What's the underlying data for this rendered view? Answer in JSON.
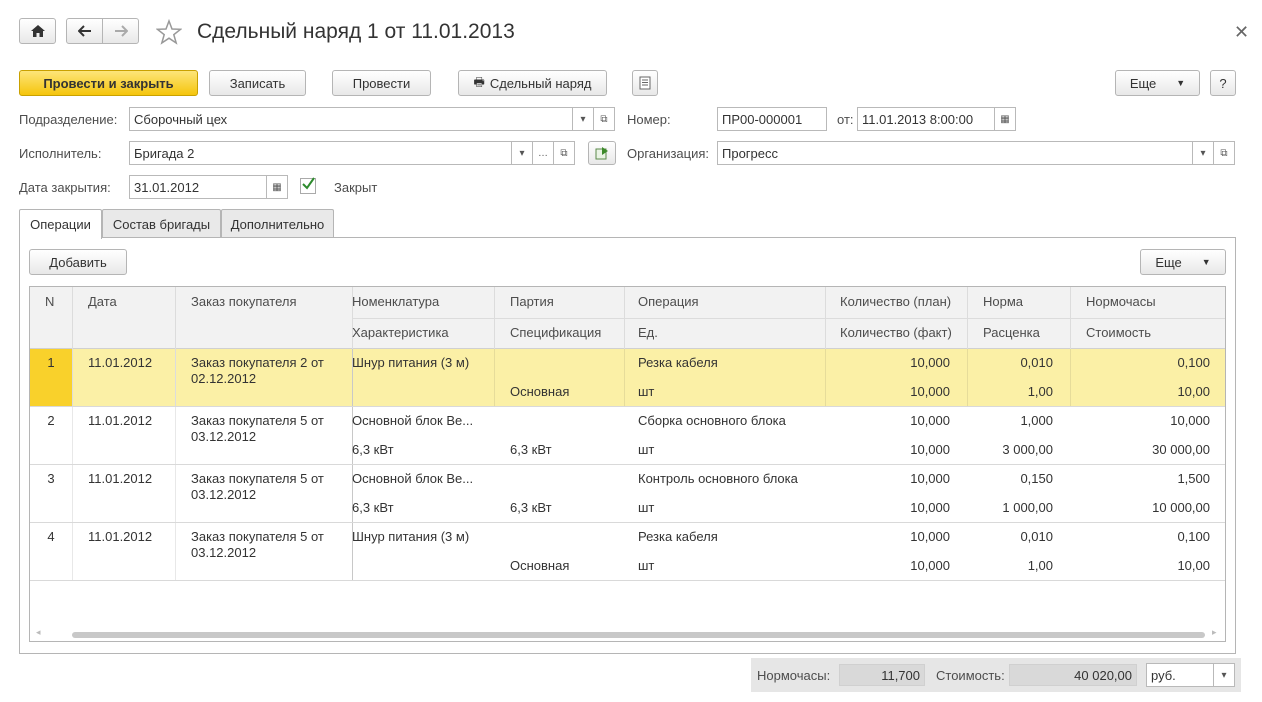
{
  "window": {
    "title": "Сдельный наряд 1 от 11.01.2013"
  },
  "toolbar": {
    "post_close": "Провести и закрыть",
    "save": "Записать",
    "post": "Провести",
    "print": "Сдельный наряд",
    "more": "Еще",
    "help": "?"
  },
  "form": {
    "division_label": "Подразделение:",
    "division_value": "Сборочный цех",
    "number_label": "Номер:",
    "number_value": "ПР00-000001",
    "from_label": "от:",
    "date_value": "11.01.2013  8:00:00",
    "executor_label": "Исполнитель:",
    "executor_value": "Бригада 2",
    "org_label": "Организация:",
    "org_value": "Прогресс",
    "close_date_label": "Дата закрытия:",
    "close_date_value": "31.01.2012",
    "closed_label": "Закрыт"
  },
  "tabs": [
    {
      "label": "Операции"
    },
    {
      "label": "Состав бригады"
    },
    {
      "label": "Дополнительно"
    }
  ],
  "table_toolbar": {
    "add": "Добавить",
    "more": "Еще"
  },
  "columns": {
    "n": "N",
    "date": "Дата",
    "order": "Заказ покупателя",
    "nomenclature": "Номенклатура",
    "characteristic": "Характеристика",
    "batch": "Партия",
    "spec": "Спецификация",
    "operation": "Операция",
    "unit": "Ед.",
    "qty_plan": "Количество (план)",
    "qty_fact": "Количество (факт)",
    "norm": "Норма",
    "rate": "Расценка",
    "norm_hours": "Нормочасы",
    "cost": "Стоимость"
  },
  "rows": [
    {
      "n": "1",
      "date": "11.01.2012",
      "order1": "Заказ покупателя 2 от",
      "order2": "02.12.2012",
      "nom": "Шнур питания (3 м)",
      "char": "",
      "batch": "",
      "spec": "Основная",
      "op": "Резка кабеля",
      "unit": "шт",
      "qplan": "10,000",
      "qfact": "10,000",
      "norm": "0,010",
      "rate": "1,00",
      "hours": "0,100",
      "cost": "10,00"
    },
    {
      "n": "2",
      "date": "11.01.2012",
      "order1": "Заказ покупателя 5 от",
      "order2": "03.12.2012",
      "nom": "Основной блок Be...",
      "char": "6,3 кВт",
      "batch": "",
      "spec": "6,3 кВт",
      "op": "Сборка основного блока",
      "unit": "шт",
      "qplan": "10,000",
      "qfact": "10,000",
      "norm": "1,000",
      "rate": "3 000,00",
      "hours": "10,000",
      "cost": "30 000,00"
    },
    {
      "n": "3",
      "date": "11.01.2012",
      "order1": "Заказ покупателя 5 от",
      "order2": "03.12.2012",
      "nom": "Основной блок Be...",
      "char": "6,3 кВт",
      "batch": "",
      "spec": "6,3 кВт",
      "op": "Контроль основного блока",
      "unit": "шт",
      "qplan": "10,000",
      "qfact": "10,000",
      "norm": "0,150",
      "rate": "1 000,00",
      "hours": "1,500",
      "cost": "10 000,00"
    },
    {
      "n": "4",
      "date": "11.01.2012",
      "order1": "Заказ покупателя 5 от",
      "order2": "03.12.2012",
      "nom": "Шнур питания (3 м)",
      "char": "",
      "batch": "",
      "spec": "Основная",
      "op": "Резка кабеля",
      "unit": "шт",
      "qplan": "10,000",
      "qfact": "10,000",
      "norm": "0,010",
      "rate": "1,00",
      "hours": "0,100",
      "cost": "10,00"
    }
  ],
  "footer": {
    "hours_label": "Нормочасы:",
    "hours_value": "11,700",
    "cost_label": "Стоимость:",
    "cost_value": "40 020,00",
    "currency": "руб."
  },
  "colors": {
    "accent_yellow": "#f5c50c",
    "selected_row": "#fbf0a6",
    "selected_cell": "#f9d12b"
  }
}
